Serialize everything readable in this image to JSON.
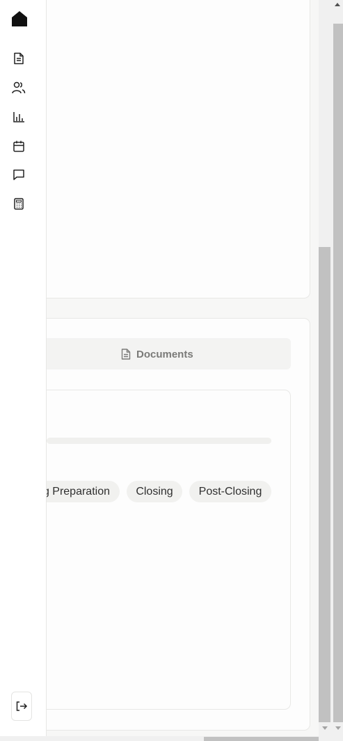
{
  "sidebar": {
    "logo_icon": "home-icon",
    "items": [
      {
        "icon": "document-icon"
      },
      {
        "icon": "users-icon"
      },
      {
        "icon": "bar-chart-icon"
      },
      {
        "icon": "calendar-icon"
      },
      {
        "icon": "message-icon"
      },
      {
        "icon": "calculator-icon"
      }
    ],
    "logout_icon": "logout-icon"
  },
  "tabs": {
    "documents_label": "Documents",
    "documents_icon": "document-icon"
  },
  "stages": {
    "preparation_label": "g Preparation",
    "closing_label": "Closing",
    "post_closing_label": "Post-Closing"
  },
  "colors": {
    "sidebar_bg": "#ffffff",
    "page_bg": "#f7f7f6",
    "pill_bg": "#f1f1ef",
    "tab_text": "#7a7a78",
    "scroll_thumb": "#c1c1c1"
  }
}
